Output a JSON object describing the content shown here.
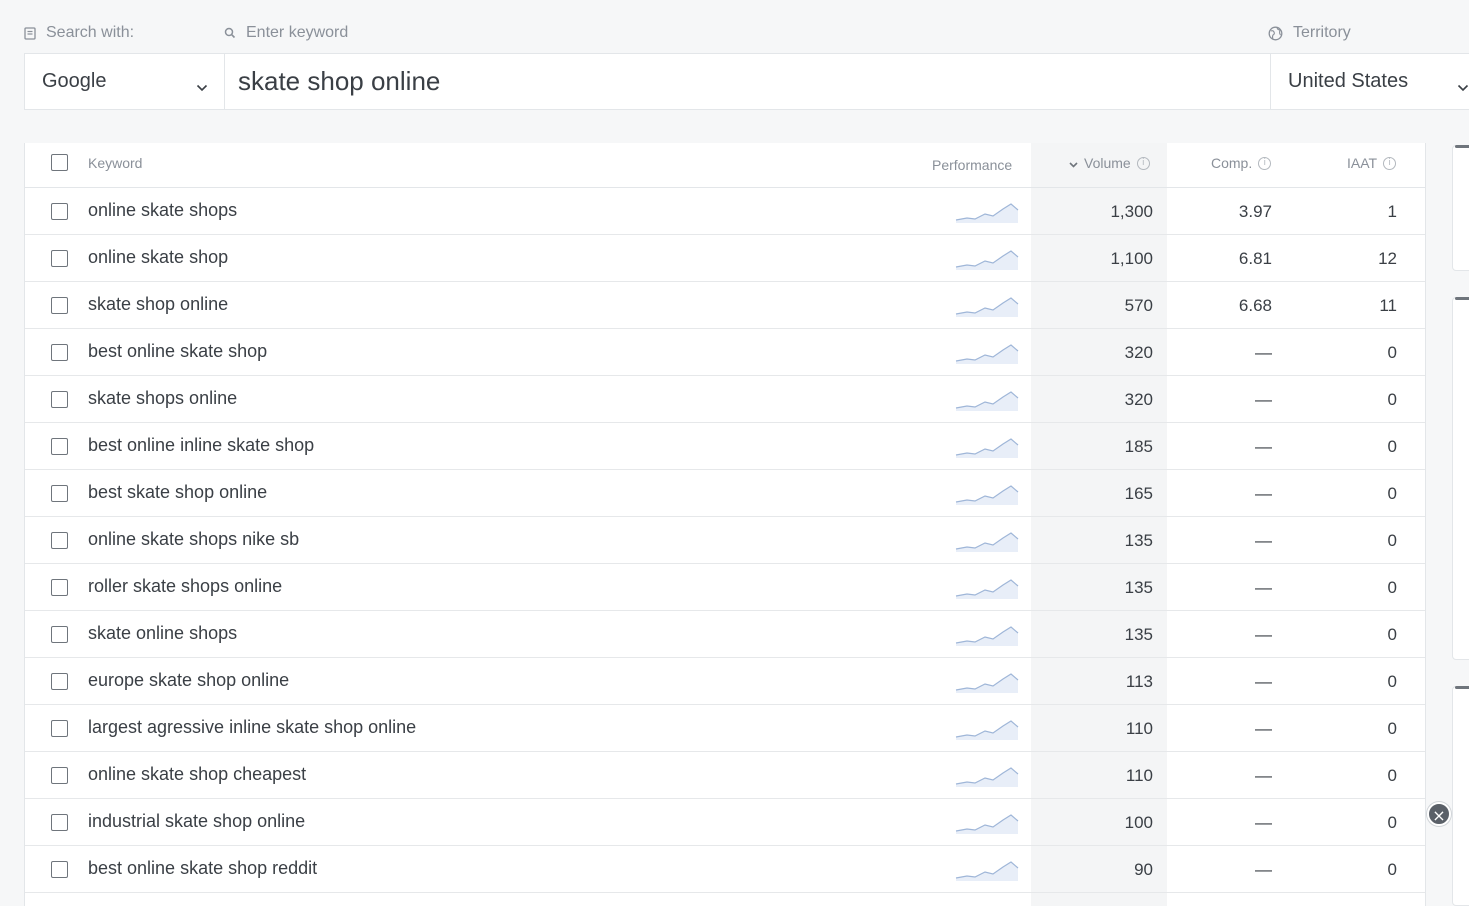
{
  "search": {
    "search_with_label": "Search with:",
    "keyword_label": "Enter keyword",
    "territory_label": "Territory",
    "engine": "Google",
    "keyword_value": "skate shop online",
    "territory_value": "United States"
  },
  "table": {
    "columns": {
      "keyword": "Keyword",
      "performance": "Performance",
      "volume": "Volume",
      "comp": "Comp.",
      "iaat": "IAAT"
    },
    "rows": [
      {
        "keyword": "online skate shops",
        "volume": "1,300",
        "comp": "3.97",
        "iaat": "1"
      },
      {
        "keyword": "online skate shop",
        "volume": "1,100",
        "comp": "6.81",
        "iaat": "12"
      },
      {
        "keyword": "skate shop online",
        "volume": "570",
        "comp": "6.68",
        "iaat": "11"
      },
      {
        "keyword": "best online skate shop",
        "volume": "320",
        "comp": "—",
        "iaat": "0"
      },
      {
        "keyword": "skate shops online",
        "volume": "320",
        "comp": "—",
        "iaat": "0"
      },
      {
        "keyword": "best online inline skate shop",
        "volume": "185",
        "comp": "—",
        "iaat": "0"
      },
      {
        "keyword": "best skate shop online",
        "volume": "165",
        "comp": "—",
        "iaat": "0"
      },
      {
        "keyword": "online skate shops nike sb",
        "volume": "135",
        "comp": "—",
        "iaat": "0"
      },
      {
        "keyword": "roller skate shops online",
        "volume": "135",
        "comp": "—",
        "iaat": "0"
      },
      {
        "keyword": "skate online shops",
        "volume": "135",
        "comp": "—",
        "iaat": "0"
      },
      {
        "keyword": "europe skate shop online",
        "volume": "113",
        "comp": "—",
        "iaat": "0"
      },
      {
        "keyword": "largest agressive inline skate shop online",
        "volume": "110",
        "comp": "—",
        "iaat": "0"
      },
      {
        "keyword": "online skate shop cheapest",
        "volume": "110",
        "comp": "—",
        "iaat": "0"
      },
      {
        "keyword": "industrial skate shop online",
        "volume": "100",
        "comp": "—",
        "iaat": "0"
      },
      {
        "keyword": "best online skate shop reddit",
        "volume": "90",
        "comp": "—",
        "iaat": "0"
      }
    ]
  },
  "icons": {
    "search_with": "document-icon",
    "keyword": "search-icon",
    "territory": "globe-icon",
    "close": "close-icon"
  },
  "colors": {
    "sparkline": "#9fb6d8",
    "sparkline_fill": "#e8eef8"
  }
}
